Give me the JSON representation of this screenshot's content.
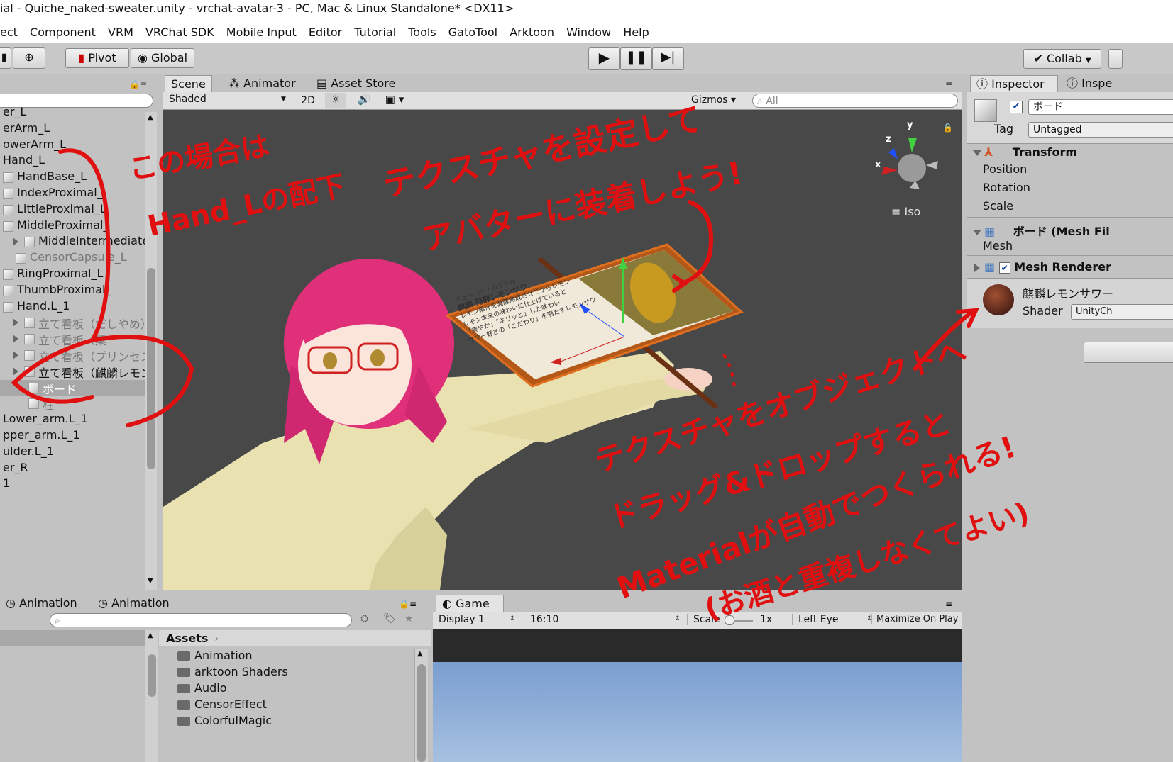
{
  "window": {
    "title": "ial - Quiche_naked-sweater.unity - vrchat-avatar-3 - PC, Mac & Linux Standalone* <DX11>"
  },
  "menu": [
    "ect",
    "Component",
    "VRM",
    "VRChat SDK",
    "Mobile Input",
    "Editor",
    "Tutorial",
    "Tools",
    "GatoTool",
    "Arktoon",
    "Window",
    "Help"
  ],
  "toolbar": {
    "pivot": "Pivot",
    "global": "Global",
    "collab": "Collab"
  },
  "hierarchy": {
    "items": [
      {
        "label": "er_L",
        "indent": 0,
        "icon": false
      },
      {
        "label": "erArm_L",
        "indent": 0,
        "icon": false
      },
      {
        "label": "owerArm_L",
        "indent": 0,
        "icon": false
      },
      {
        "label": "Hand_L",
        "indent": 0,
        "icon": false
      },
      {
        "label": "HandBase_L",
        "indent": 0,
        "icon": true
      },
      {
        "label": "IndexProximal_",
        "indent": 0,
        "icon": true
      },
      {
        "label": "LittleProximal_L",
        "indent": 0,
        "icon": true
      },
      {
        "label": "MiddleProximal_",
        "indent": 0,
        "icon": true
      },
      {
        "label": "MiddleIntermediate",
        "indent": 1,
        "icon": true,
        "arrow": true
      },
      {
        "label": "CensorCapsule_L",
        "indent": 1,
        "icon": true,
        "dim": true
      },
      {
        "label": "RingProximal_L",
        "indent": 0,
        "icon": true
      },
      {
        "label": "ThumbProximal_",
        "indent": 0,
        "icon": true
      },
      {
        "label": "Hand.L_1",
        "indent": 0,
        "icon": true
      },
      {
        "label": "立て看板（だしやめ）",
        "indent": 1,
        "icon": true,
        "arrow": true,
        "dim": true
      },
      {
        "label": "立て看板（菓",
        "indent": 1,
        "icon": true,
        "arrow": true,
        "dim": true
      },
      {
        "label": "立て看板（プリンセス",
        "indent": 1,
        "icon": true,
        "arrow": true,
        "dim": true
      },
      {
        "label": "立て看板（麒麟レモン",
        "indent": 1,
        "icon": true,
        "arrow": true
      },
      {
        "label": "ボード",
        "indent": 2,
        "icon": true,
        "selected": true
      },
      {
        "label": "柱",
        "indent": 2,
        "icon": true,
        "dim": true
      },
      {
        "label": "Lower_arm.L_1",
        "indent": 0,
        "icon": false
      },
      {
        "label": "pper_arm.L_1",
        "indent": 0,
        "icon": false
      },
      {
        "label": "ulder.L_1",
        "indent": 0,
        "icon": false
      },
      {
        "label": "er_R",
        "indent": 0,
        "icon": false
      },
      {
        "label": "1",
        "indent": 0,
        "icon": false
      }
    ]
  },
  "scene": {
    "tabs": [
      "Scene",
      "Animator",
      "Asset Store"
    ],
    "shading": "Shaded",
    "mode2d": "2D",
    "gizmos": "Gizmos",
    "search_placeholder": "All",
    "iso": "Iso",
    "axis_x": "x",
    "axis_y": "y",
    "axis_z": "z",
    "board_text": [
      "チューハイ・カクテル",
      "麒麟 発酵レモンサワ",
      "レモン果汁を発酵熟成させてからレモン",
      "レモン本来の味わいに仕上げていると",
      "「爽やか」「キリッと」した味わい",
      "サワー好きの「こだわり」を満たすレモンサワ"
    ]
  },
  "inspector": {
    "tabs": [
      "Inspector",
      "Inspe"
    ],
    "object_name": "ボード",
    "tag_label": "Tag",
    "tag_value": "Untagged",
    "transform": {
      "title": "Transform",
      "fields": [
        "Position",
        "Rotation",
        "Scale"
      ]
    },
    "mesh_filter": {
      "title": "ボード (Mesh Fil",
      "field": "Mesh"
    },
    "mesh_renderer": {
      "title": "Mesh Renderer"
    },
    "material": {
      "name": "麒麟レモンサワー",
      "shader_label": "Shader",
      "shader_value": "UnityCh"
    }
  },
  "bottom_left": {
    "tabs": [
      "Animation",
      "Animation"
    ]
  },
  "project": {
    "breadcrumb": "Assets",
    "folders": [
      "Animation",
      "arktoon Shaders",
      "Audio",
      "CensorEffect",
      "ColorfulMagic"
    ]
  },
  "game": {
    "tab": "Game",
    "display": "Display 1",
    "aspect": "16:10",
    "scale_label": "Scale",
    "scale_value": "1x",
    "eye": "Left Eye",
    "maximize": "Maximize On Play"
  },
  "annotations": {
    "line1a": "この場合は",
    "line1b": "Hand_Lの配下",
    "line2a": "テクスチャを設定して",
    "line2b": "アバターに装着しよう!",
    "line3a": "テクスチャをオブジェクトへ",
    "line3b": "ドラッグ&ドロップすると",
    "line3c": "Materialが自動でつくられる!",
    "line3d": "(お酒と重複しなくてよい)"
  },
  "colors": {
    "annotation": "#e01010",
    "scene_bg": "#484848",
    "selection": "#a8a8a8"
  }
}
